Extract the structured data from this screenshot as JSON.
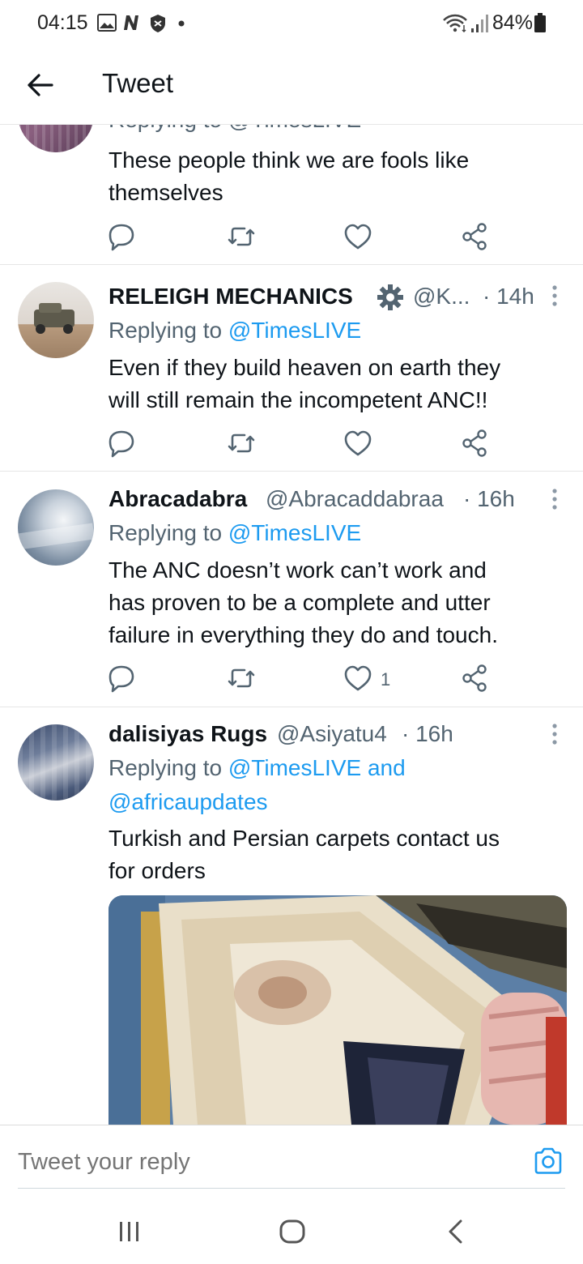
{
  "status_bar": {
    "time": "04:15",
    "battery": "84%"
  },
  "header": {
    "title": "Tweet"
  },
  "tweets": [
    {
      "partial_replying": "Replying to @TimesLIVE",
      "text_lines": [
        "These people think we are fools like",
        "themselves"
      ]
    },
    {
      "name": "RELEIGH MECHANICS",
      "handle": "@K...",
      "time": "· 14h",
      "replying_prefix": "Replying to ",
      "replying_to": "@TimesLIVE",
      "text_lines": [
        "Even if they build heaven on earth they",
        "will still remain the incompetent ANC!!"
      ]
    },
    {
      "name": "Abracadabra",
      "handle": "@Abracaddabraa",
      "time": "· 16h",
      "replying_prefix": "Replying to ",
      "replying_to": "@TimesLIVE",
      "text_lines": [
        "The ANC doesn’t work can’t work and",
        "has proven to be a complete and utter",
        "failure in everything they do and touch."
      ],
      "like_count": "1"
    },
    {
      "name": "dalisiyas Rugs",
      "handle": "@Asiyatu4",
      "time": "· 16h",
      "replying_prefix": "Replying to ",
      "replying_to": "@TimesLIVE and",
      "replying_to_2": "@africaupdates",
      "text_lines": [
        "Turkish and Persian carpets contact us",
        "for orders"
      ]
    }
  ],
  "reply_bar": {
    "placeholder": "Tweet your reply"
  },
  "colors": {
    "link": "#1d9bf0",
    "text": "#0f1419",
    "secondary": "#536471"
  }
}
